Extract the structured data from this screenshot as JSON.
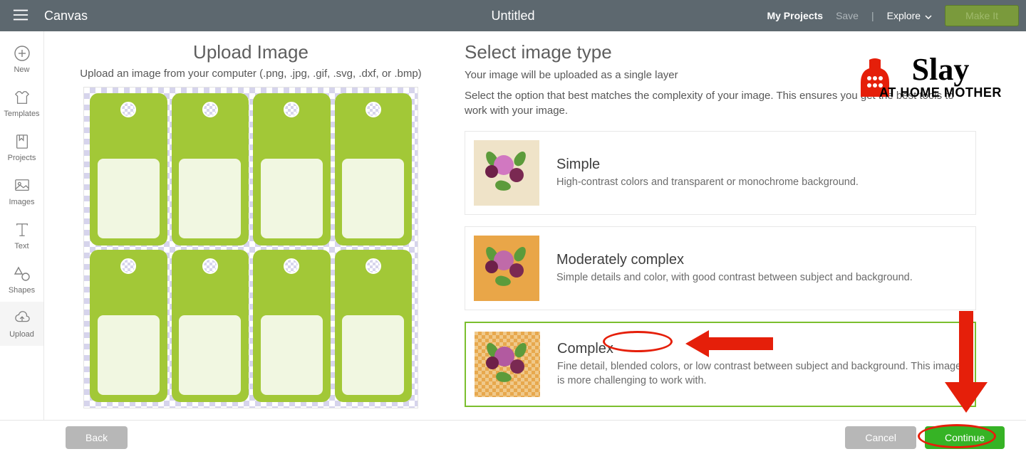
{
  "topbar": {
    "canvas_label": "Canvas",
    "document_title": "Untitled",
    "my_projects": "My Projects",
    "save": "Save",
    "explore": "Explore",
    "make_it": "Make It"
  },
  "sidebar": {
    "items": [
      {
        "label": "New",
        "icon": "plus-circle-icon"
      },
      {
        "label": "Templates",
        "icon": "shirt-icon"
      },
      {
        "label": "Projects",
        "icon": "bookmark-page-icon"
      },
      {
        "label": "Images",
        "icon": "image-icon"
      },
      {
        "label": "Text",
        "icon": "text-icon"
      },
      {
        "label": "Shapes",
        "icon": "shapes-icon"
      },
      {
        "label": "Upload",
        "icon": "upload-cloud-icon"
      }
    ]
  },
  "upload_panel": {
    "heading": "Upload Image",
    "hint": "Upload an image from your computer (.png, .jpg, .gif, .svg, .dxf, or .bmp)"
  },
  "select_panel": {
    "heading": "Select image type",
    "line1": "Your image will be uploaded as a single layer",
    "line2": "Select the option that best matches the complexity of your image. This ensures you get the best tools to work with your image.",
    "options": [
      {
        "key": "simple",
        "title": "Simple",
        "desc": "High-contrast colors and transparent or monochrome background."
      },
      {
        "key": "moderate",
        "title": "Moderately complex",
        "desc": "Simple details and color, with good contrast between subject and background."
      },
      {
        "key": "complex",
        "title": "Complex",
        "desc": "Fine detail, blended colors, or low contrast between subject and background. This image is more challenging to work with."
      }
    ],
    "selected": "complex"
  },
  "bottom": {
    "back": "Back",
    "cancel": "Cancel",
    "continue": "Continue"
  },
  "watermark": {
    "line1": "Slay",
    "line2": "AT HOME MOTHER"
  },
  "colors": {
    "topbar": "#5d686f",
    "accent_green": "#36b325",
    "tag_green": "#a2c837",
    "selected_border": "#7bbf2e",
    "annotation_red": "#e51f0a"
  }
}
